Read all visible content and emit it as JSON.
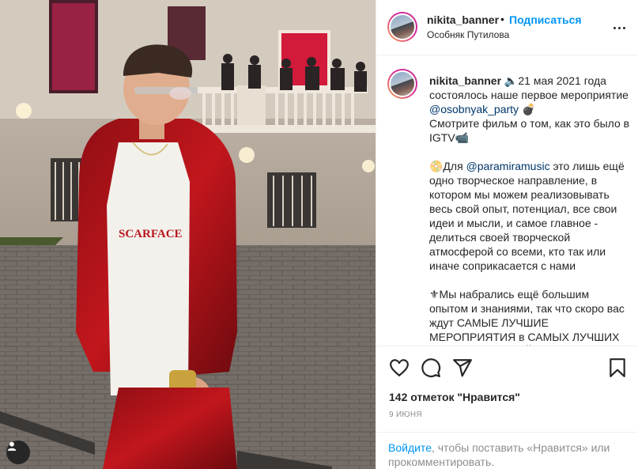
{
  "header": {
    "username": "nikita_banner",
    "separator": "•",
    "follow_label": "Подписаться",
    "location": "Особняк Путилова"
  },
  "caption": {
    "username": "nikita_banner",
    "line1": "🔈21 мая 2021 года состоялось наше первое мероприятие ",
    "mention1": "@osobnyak_party",
    "line1_end": " 💣",
    "line2": "Смотрите фильм о том, как это было в IGTV📹",
    "line3_start": "📀Для ",
    "mention2": "@paramiramusic",
    "line3_end": " это лишь ещё одно творческое направление, в котором мы можем реализовывать весь свой опыт, потенциал, все свои идеи и мысли, и самое главное - делиться своей творческой атмосферой со всеми, кто так или иначе соприкасается с нами",
    "line4": "⚜Мы набрались ещё большим опытом и знаниями, так что скоро вас ждут САМЫЕ ЛУЧШИЕ МЕРОПРИЯТИЯ в САМЫХ ЛУЧШИХ МЕСТАХ от САМОЙ"
  },
  "icons": {
    "like": "heart-icon",
    "comment": "comment-icon",
    "share": "share-icon",
    "save": "bookmark-icon",
    "tag": "user-tag-icon"
  },
  "likes": "142 отметок \"Нравится\"",
  "date": "9 июня",
  "footer": {
    "login_link": "Войдите",
    "login_text": ", чтобы поставить «Нравится» или прокомментировать."
  },
  "photo": {
    "shirt_text": "SCARFACE"
  },
  "colors": {
    "link": "#0095f6",
    "mention": "#00376b",
    "muted": "#8e8e8e",
    "text": "#262626",
    "border": "#efefef"
  }
}
